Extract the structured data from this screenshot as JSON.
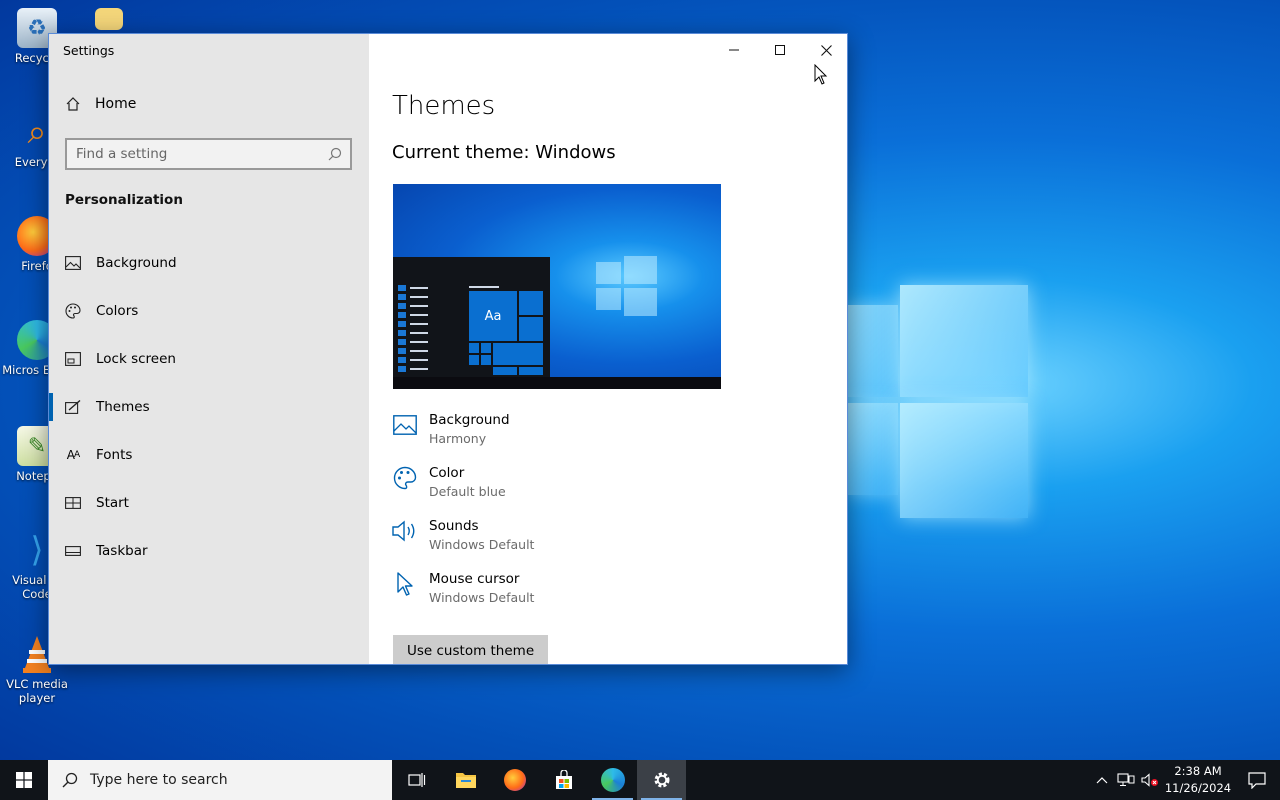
{
  "desktop": {
    "icons": [
      {
        "label": "Recycle",
        "icon": "recycle-bin-icon"
      },
      {
        "label": "Everyth",
        "icon": "everything-search-icon"
      },
      {
        "label": "Firefo",
        "icon": "firefox-icon"
      },
      {
        "label": "Micros Edge",
        "icon": "edge-icon"
      },
      {
        "label": "Notepa",
        "icon": "notepad-plus-icon"
      },
      {
        "label": "Visual St Code",
        "icon": "vscode-icon"
      },
      {
        "label": "VLC media player",
        "icon": "vlc-icon"
      }
    ]
  },
  "window": {
    "title": "Settings",
    "controls": {
      "minimize": "minimize-icon",
      "maximize": "maximize-icon",
      "close": "close-icon"
    }
  },
  "sidebar": {
    "home_label": "Home",
    "search_placeholder": "Find a setting",
    "section_title": "Personalization",
    "items": [
      {
        "label": "Background",
        "icon": "picture-icon"
      },
      {
        "label": "Colors",
        "icon": "palette-icon"
      },
      {
        "label": "Lock screen",
        "icon": "lock-screen-icon"
      },
      {
        "label": "Themes",
        "icon": "brush-icon",
        "active": true
      },
      {
        "label": "Fonts",
        "icon": "fonts-icon"
      },
      {
        "label": "Start",
        "icon": "start-icon"
      },
      {
        "label": "Taskbar",
        "icon": "taskbar-icon"
      }
    ]
  },
  "main": {
    "title": "Themes",
    "current_theme": "Current theme: Windows",
    "preview_tile_text": "Aa",
    "properties": [
      {
        "name": "Background",
        "value": "Harmony",
        "icon": "picture-icon"
      },
      {
        "name": "Color",
        "value": "Default blue",
        "icon": "palette-icon"
      },
      {
        "name": "Sounds",
        "value": "Windows Default",
        "icon": "speaker-icon"
      },
      {
        "name": "Mouse cursor",
        "value": "Windows Default",
        "icon": "cursor-icon"
      }
    ],
    "custom_button": "Use custom theme"
  },
  "taskbar": {
    "search_placeholder": "Type here to search",
    "apps": [
      {
        "name": "task-view",
        "icon": "task-view-icon"
      },
      {
        "name": "file-explorer",
        "icon": "folder-icon"
      },
      {
        "name": "firefox",
        "icon": "firefox-icon"
      },
      {
        "name": "microsoft-store",
        "icon": "store-icon"
      },
      {
        "name": "edge",
        "icon": "edge-icon",
        "running": true
      },
      {
        "name": "settings",
        "icon": "gear-icon",
        "running": true,
        "active": true
      }
    ],
    "time": "2:38 AM",
    "date": "11/26/2024"
  },
  "colors": {
    "accent": "#0063b1",
    "sidebar_bg": "#e6e6e6",
    "taskbar_bg": "#101419"
  }
}
